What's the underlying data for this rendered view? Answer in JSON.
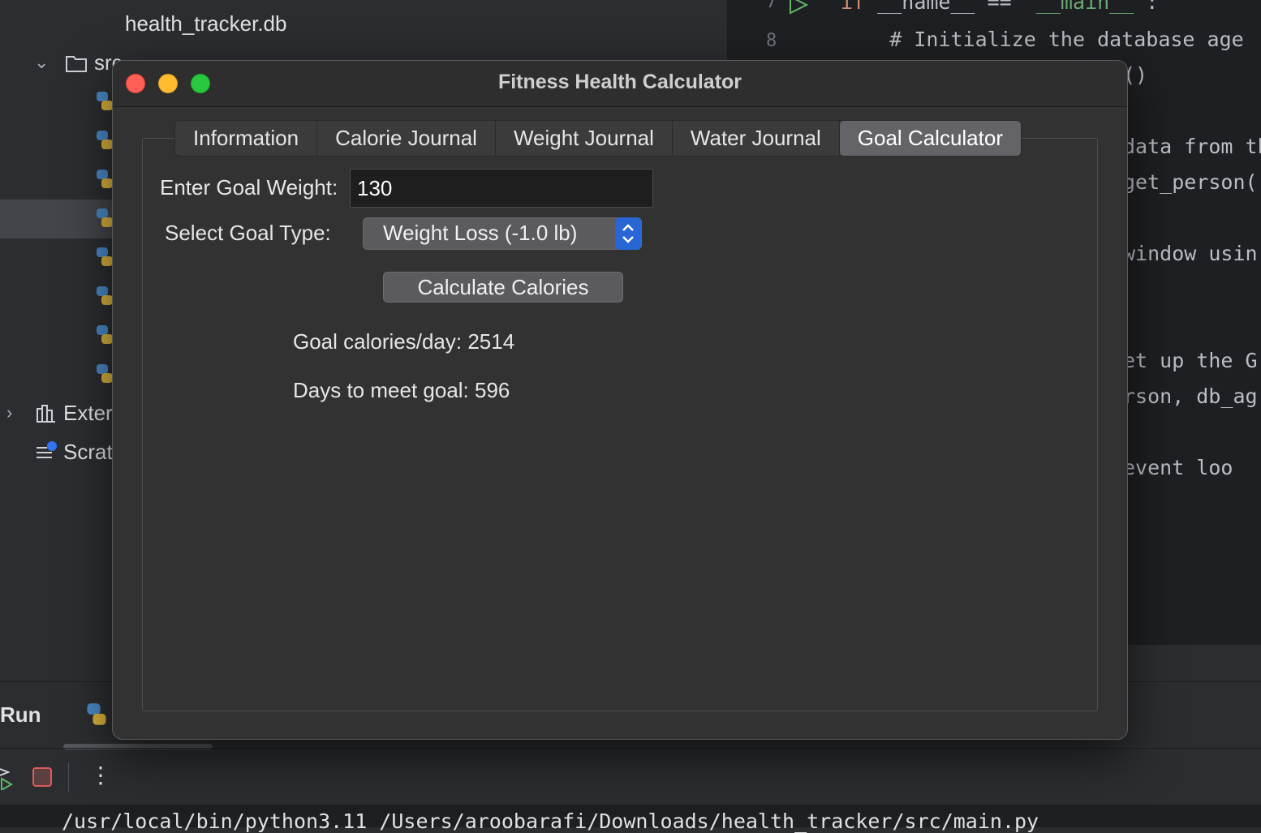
{
  "ide": {
    "tree_file": "health_tracker.db",
    "folder_label": "src",
    "external_label": "Exter",
    "scratch_label": "Scrat",
    "line_numbers": [
      "7",
      "8"
    ],
    "code_lines": [
      "if __name__ == \"__main__\":",
      "    # Initialize the database age",
      "()",
      "data from th",
      "get_person(",
      "window usin",
      "et up the G",
      "rson, db_ag",
      "event loo"
    ],
    "run_label": "Run",
    "terminal_line": "/usr/local/bin/python3.11 /Users/aroobarafi/Downloads/health_tracker/src/main.py"
  },
  "window": {
    "title": "Fitness Health Calculator",
    "tabs": [
      {
        "label": "Information",
        "active": false
      },
      {
        "label": "Calorie Journal",
        "active": false
      },
      {
        "label": "Weight Journal",
        "active": false
      },
      {
        "label": "Water Journal",
        "active": false
      },
      {
        "label": "Goal Calculator",
        "active": true
      }
    ],
    "goal_weight_label": "Enter Goal Weight:",
    "goal_weight_value": "130",
    "goal_type_label": "Select Goal Type:",
    "goal_type_value": "Weight Loss (-1.0 lb)",
    "calculate_button": "Calculate Calories",
    "result_calories": "Goal calories/day: 2514",
    "result_days": "Days to meet goal: 596"
  }
}
